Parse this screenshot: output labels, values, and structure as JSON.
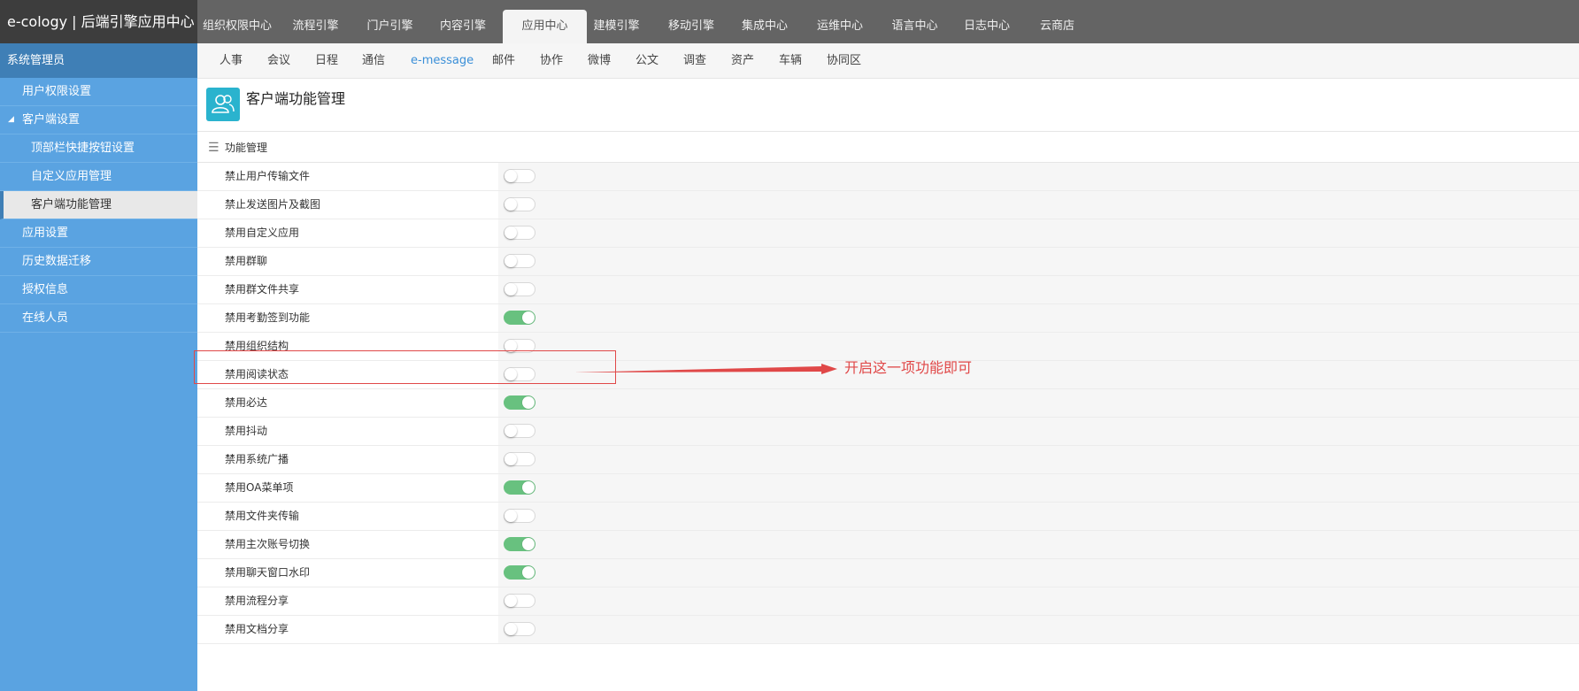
{
  "app": {
    "brand": "e-cology | 后端引擎应用中心"
  },
  "sidebar": {
    "role": "系统管理员",
    "items": [
      {
        "label": "用户权限设置",
        "level": 1
      },
      {
        "label": "客户端设置",
        "level": 1,
        "expanded": true
      },
      {
        "label": "顶部栏快捷按钮设置",
        "level": 2
      },
      {
        "label": "自定义应用管理",
        "level": 2
      },
      {
        "label": "客户端功能管理",
        "level": 2,
        "active": true
      },
      {
        "label": "应用设置",
        "level": 1
      },
      {
        "label": "历史数据迁移",
        "level": 1
      },
      {
        "label": "授权信息",
        "level": 1
      },
      {
        "label": "在线人员",
        "level": 1
      }
    ],
    "caret_glyph": "◢"
  },
  "topnav": {
    "tabs": [
      {
        "label": "组织权限中心"
      },
      {
        "label": "流程引擎"
      },
      {
        "label": "门户引擎"
      },
      {
        "label": "内容引擎"
      },
      {
        "label": "应用中心",
        "active": true
      },
      {
        "label": "建模引擎"
      },
      {
        "label": "移动引擎"
      },
      {
        "label": "集成中心"
      },
      {
        "label": "运维中心"
      },
      {
        "label": "语言中心"
      },
      {
        "label": "日志中心"
      },
      {
        "label": "云商店"
      }
    ]
  },
  "subnav": {
    "items": [
      {
        "label": "人事"
      },
      {
        "label": "会议"
      },
      {
        "label": "日程"
      },
      {
        "label": "通信"
      },
      {
        "label": "e-message",
        "active": true
      },
      {
        "label": "邮件"
      },
      {
        "label": "协作"
      },
      {
        "label": "微博"
      },
      {
        "label": "公文"
      },
      {
        "label": "调查"
      },
      {
        "label": "资产"
      },
      {
        "label": "车辆"
      },
      {
        "label": "协同区"
      }
    ]
  },
  "page": {
    "title": "客户端功能管理",
    "icon": "users-icon"
  },
  "section": {
    "title": "功能管理",
    "menu_glyph": "☰",
    "settings": [
      {
        "label": "禁止用户传输文件",
        "enabled": false
      },
      {
        "label": "禁止发送图片及截图",
        "enabled": false
      },
      {
        "label": "禁用自定义应用",
        "enabled": false
      },
      {
        "label": "禁用群聊",
        "enabled": false
      },
      {
        "label": "禁用群文件共享",
        "enabled": false
      },
      {
        "label": "禁用考勤签到功能",
        "enabled": true
      },
      {
        "label": "禁用组织结构",
        "enabled": false
      },
      {
        "label": "禁用阅读状态",
        "enabled": false,
        "highlighted": true
      },
      {
        "label": "禁用必达",
        "enabled": true
      },
      {
        "label": "禁用抖动",
        "enabled": false
      },
      {
        "label": "禁用系统广播",
        "enabled": false
      },
      {
        "label": "禁用OA菜单项",
        "enabled": true
      },
      {
        "label": "禁用文件夹传输",
        "enabled": false
      },
      {
        "label": "禁用主次账号切换",
        "enabled": true
      },
      {
        "label": "禁用聊天窗口水印",
        "enabled": true
      },
      {
        "label": "禁用流程分享",
        "enabled": false
      },
      {
        "label": "禁用文档分享",
        "enabled": false
      }
    ]
  },
  "annotation": {
    "text": "开启这一项功能即可",
    "color": "#e04848"
  },
  "colors": {
    "sidebar": "#5aa3e1",
    "brand_bar": "#3d3d3d",
    "topnav": "#646464",
    "toggle_on": "#68c17f",
    "accent": "#3a8fd8"
  }
}
